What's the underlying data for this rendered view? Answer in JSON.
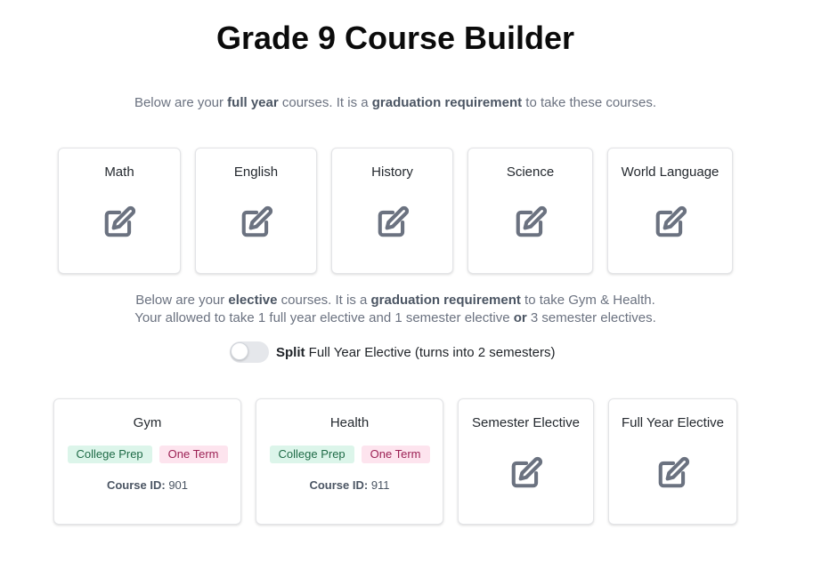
{
  "page": {
    "title": "Grade 9 Course Builder",
    "intro_core": {
      "t1": "Below are your ",
      "b1": "full year",
      "t2": " courses. It is a ",
      "b2": "graduation requirement",
      "t3": " to take these courses."
    },
    "intro_elective": {
      "t1": "Below are your ",
      "b1": "elective",
      "t2": " courses. It is a ",
      "b2": "graduation requirement",
      "t3": " to take Gym & Health.",
      "l2_t1": "Your allowed to take 1 full year elective and 1 semester elective ",
      "l2_b1": "or",
      "l2_t2": " 3 semester electives."
    }
  },
  "core_courses": [
    {
      "label": "Math",
      "icon": "edit-icon"
    },
    {
      "label": "English",
      "icon": "edit-icon"
    },
    {
      "label": "History",
      "icon": "edit-icon"
    },
    {
      "label": "Science",
      "icon": "edit-icon"
    },
    {
      "label": "World Language",
      "icon": "edit-icon"
    }
  ],
  "split_toggle": {
    "bold": "Split",
    "text": " Full Year Elective (turns into 2 semesters)",
    "on": false
  },
  "elective_courses": [
    {
      "label": "Gym",
      "badges": [
        "College Prep",
        "One Term"
      ],
      "course_id_label": "Course ID:",
      "course_id": "901"
    },
    {
      "label": "Health",
      "badges": [
        "College Prep",
        "One Term"
      ],
      "course_id_label": "Course ID:",
      "course_id": "911"
    },
    {
      "label": "Semester Elective",
      "icon": "edit-icon"
    },
    {
      "label": "Full Year Elective",
      "icon": "edit-icon"
    }
  ],
  "colors": {
    "icon": "#6b7280",
    "badge_green_bg": "#dcf5ea",
    "badge_green_text": "#1f6b47",
    "badge_pink_bg": "#fde4ee",
    "badge_pink_text": "#9c2154"
  }
}
